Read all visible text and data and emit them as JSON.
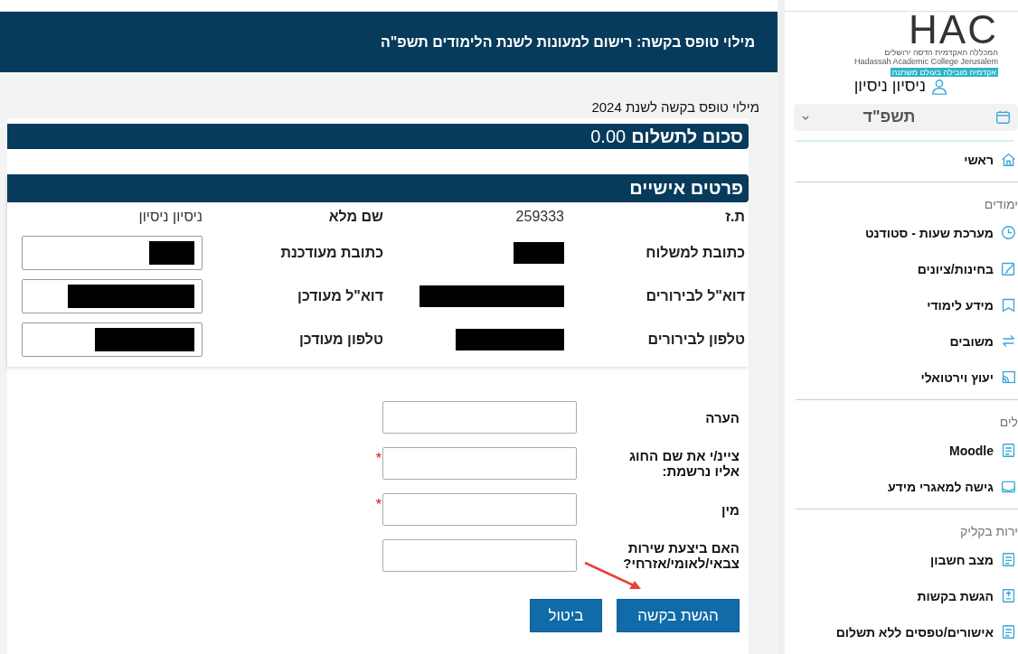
{
  "header": {
    "title": "מילוי טופס בקשה: רישום למעונות לשנת הלימודים תשפ\"ה"
  },
  "page_title": "מילוי טופס בקשה לשנת 2024",
  "payment": {
    "label": "סכום לתשלום",
    "amount": "0.00"
  },
  "details": {
    "title": "פרטים אישיים",
    "rows": [
      {
        "label": "ת.ז",
        "value": "259333",
        "label_2": "שם מלא",
        "value_2": "ניסיון ניסיון",
        "kind": "text"
      },
      {
        "label": "כתובת למשלוח",
        "label_2": "כתובת מעודכנת",
        "kind": "input"
      },
      {
        "label": "דוא\"ל לבירורים",
        "label_2": "דוא\"ל מעודכן",
        "kind": "input"
      },
      {
        "label": "טלפון לבירורים",
        "label_2": "טלפון מעודכן",
        "kind": "input"
      }
    ]
  },
  "form": {
    "fields": [
      {
        "label": "הערה"
      },
      {
        "label": "ציינ/י את שם החוג אליו נרשמת:",
        "mark": "*"
      },
      {
        "label": "מין",
        "mark": "*"
      },
      {
        "label": "האם ביצעת שירות צבאי/לאומי/אזרחי?"
      }
    ]
  },
  "buttons": [
    {
      "label": "הגשת בקשה",
      "kind": "submit"
    },
    {
      "label": "ביטול",
      "kind": "cancel"
    }
  ],
  "sidebar": {
    "logo": {
      "mark": "HAC",
      "name_he": "המכללה האקדמית הדסה ירושלים",
      "name_en": "Hadassah Academic College Jerusalem",
      "slogan": "אקדמיה מובילה בעולם משתנה"
    },
    "user": "ניסיון ניסיון",
    "year": {
      "label": "תשפ\"ד"
    },
    "groups": [
      {
        "items": [
          "ראשי"
        ]
      },
      {
        "heading": "ימודים",
        "items": [
          "מערכת שעות - סטודנט",
          "בחינות/ציונים",
          "מידע לימודי",
          "משובים",
          "יעוץ וירטואלי"
        ]
      },
      {
        "heading": "לים",
        "items": [
          "Moodle",
          "גישה למאגרי מידע"
        ]
      },
      {
        "heading": "ירות בקליק",
        "items": [
          "מצב חשבון",
          "הגשת בקשות",
          "אישורים/טפסים ללא תשלום"
        ]
      }
    ]
  }
}
